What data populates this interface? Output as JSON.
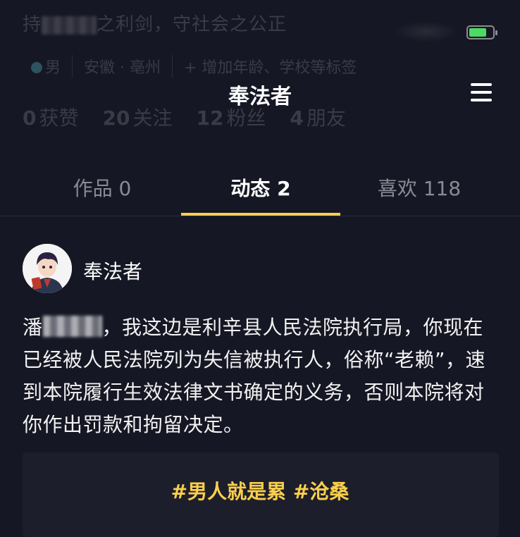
{
  "profile": {
    "bio": "持法律之利剑，守社会之公正",
    "bio_start": "持",
    "bio_end": "之利剑，守社会之公正",
    "gender": "男",
    "location": "安徽 · 亳州",
    "add_tags": "+ 增加年龄、学校等标签",
    "stats": [
      {
        "num": "0",
        "label": "获赞"
      },
      {
        "num": "20",
        "label": "关注"
      },
      {
        "num": "12",
        "label": "粉丝"
      },
      {
        "num": "4",
        "label": "朋友"
      }
    ]
  },
  "header": {
    "title": "奉法者",
    "menu_icon": "hamburger-menu-icon"
  },
  "status_bar": {
    "battery_level": 0.75,
    "battery_color": "#4cd964"
  },
  "tabs": [
    {
      "label": "作品 0"
    },
    {
      "label": "动态 2"
    },
    {
      "label": "喜欢 118"
    }
  ],
  "active_tab": 1,
  "accent_color": "#facf4c",
  "post": {
    "author": "奉法者",
    "name_prefix": "潘",
    "text": "，我这边是利辛县人民法院执行局，你现在已经被人民法院列为失信被执行人，俗称“老赖”，速到本院履行生效法律文书确定的义务，否则本院将对你作出罚款和拘留决定。",
    "hashtags": "#男人就是累 #沧桑"
  }
}
